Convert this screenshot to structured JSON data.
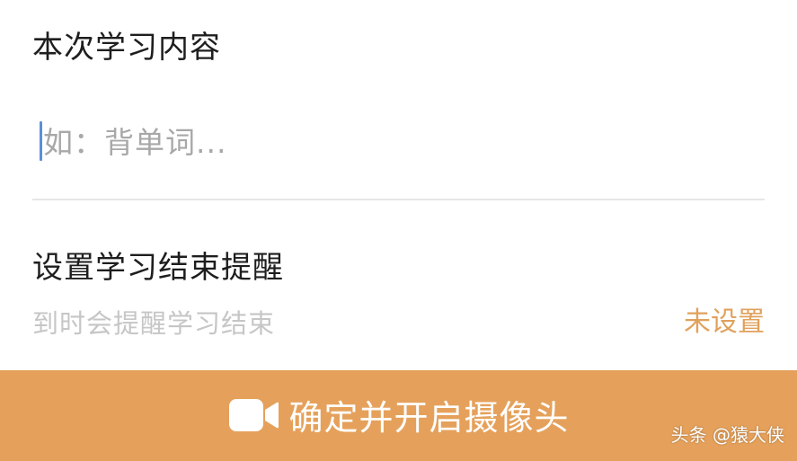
{
  "study_section": {
    "title": "本次学习内容",
    "input_placeholder": "如：背单词...",
    "input_value": ""
  },
  "reminder_section": {
    "title": "设置学习结束提醒",
    "description": "到时会提醒学习结束",
    "status": "未设置"
  },
  "confirm_button": {
    "label": "确定并开启摄像头",
    "icon": "video-camera-icon"
  },
  "watermark": {
    "text": "头条 @猿大侠"
  },
  "colors": {
    "accent": "#e5a15b",
    "status_text": "#e0a15c",
    "cursor": "#5b8fd6",
    "divider": "#e6e6e6",
    "title_text": "#1e1e1e",
    "placeholder_text": "#a8a8a8",
    "description_text": "#c6c6c6"
  }
}
